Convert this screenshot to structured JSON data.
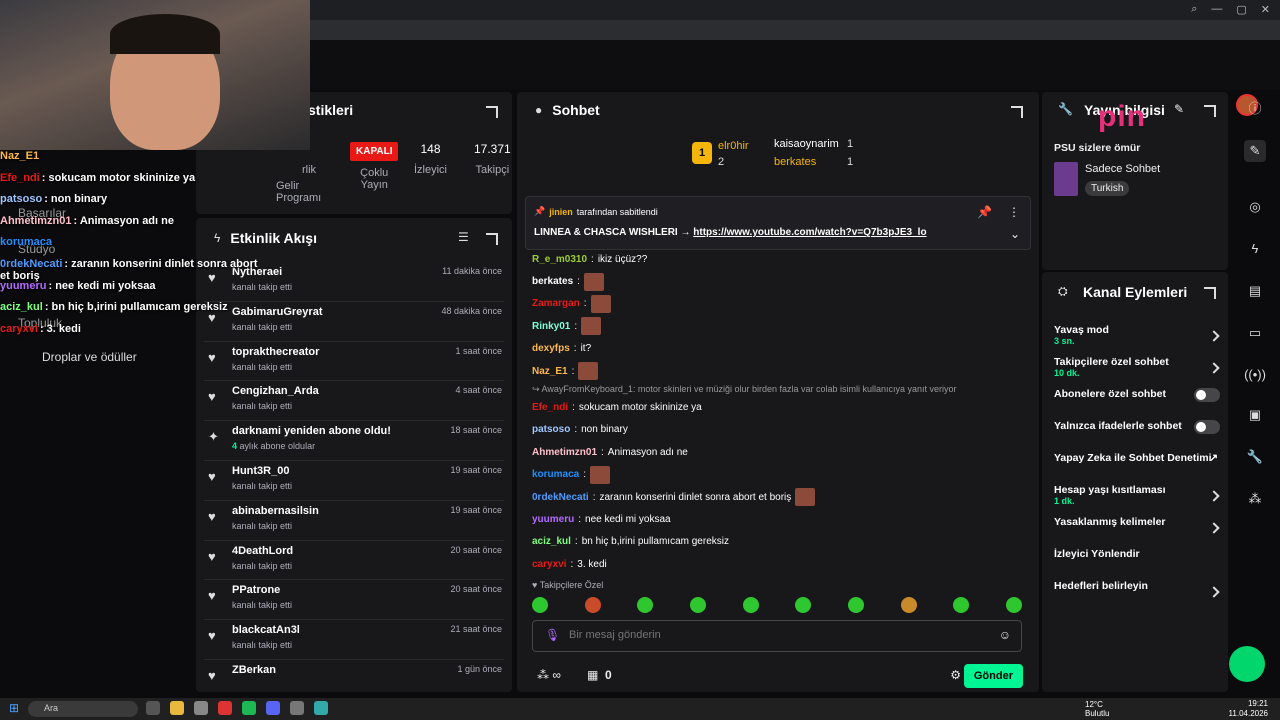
{
  "stats": {
    "title_partial": "stikleri",
    "status_badge": "KAPALI",
    "viewers": "148",
    "viewers_label": "İzleyici",
    "followers": "17.371",
    "followers_label": "Takipçi",
    "multi_label_1": "Çoklu",
    "multi_label_2": "Yayın",
    "income_label_1": "Gelir",
    "income_label_2": "Programı",
    "partial_lik": "rlik"
  },
  "feed": {
    "title": "Etkinlik Akışı",
    "items": [
      {
        "name": "Nytheraei",
        "sub": "kanalı takip etti",
        "time": "11 dakika önce",
        "icon": "heart"
      },
      {
        "name": "GabimaruGreyrat",
        "sub": "kanalı takip etti",
        "time": "48 dakika önce",
        "icon": "heart"
      },
      {
        "name": "toprakthecreator",
        "sub": "kanalı takip etti",
        "time": "1 saat önce",
        "icon": "heart"
      },
      {
        "name": "Cengizhan_Arda",
        "sub": "kanalı takip etti",
        "time": "4 saat önce",
        "icon": "heart"
      },
      {
        "name": "darknami yeniden abone oldu!",
        "sub_count": "4",
        "sub": " aylık abone oldular",
        "time": "18 saat önce",
        "icon": "star"
      },
      {
        "name": "Hunt3R_00",
        "sub": "kanalı takip etti",
        "time": "19 saat önce",
        "icon": "heart"
      },
      {
        "name": "abinabernasilsin",
        "sub": "kanalı takip etti",
        "time": "19 saat önce",
        "icon": "heart"
      },
      {
        "name": "4DeathLord",
        "sub": "kanalı takip etti",
        "time": "20 saat önce",
        "icon": "heart"
      },
      {
        "name": "PPatrone",
        "sub": "kanalı takip etti",
        "time": "20 saat önce",
        "icon": "heart"
      },
      {
        "name": "blackcatAn3l",
        "sub": "kanalı takip etti",
        "time": "21 saat önce",
        "icon": "heart"
      },
      {
        "name": "ZBerkan",
        "sub": "",
        "time": "1 gün önce",
        "icon": "heart"
      }
    ]
  },
  "chat": {
    "title": "Sohbet",
    "leaders": [
      {
        "rank": "1",
        "name": "elr0hir",
        "count": "2"
      },
      {
        "name": "kaisaoynarim",
        "count": "1"
      },
      {
        "name": "berkates",
        "count": "1"
      }
    ],
    "pinned": {
      "by_user": "jinien",
      "by_text": "tarafından sabitlendi",
      "text": "LINNEA & CHASCA WISHLERI →",
      "link": "https://www.youtube.com/watch?v=Q7b3pJE3_lo"
    },
    "messages": [
      {
        "user": "R_e_m0310",
        "color": "#9acd32",
        "text": "ikiz üçüz??",
        "emote": false
      },
      {
        "user": "berkates",
        "color": "#ffffff",
        "text": "",
        "emote": true
      },
      {
        "user": "Zamargan",
        "color": "#e91916",
        "text": "",
        "emote": true
      },
      {
        "user": "Rinky01",
        "color": "#7fffd4",
        "text": "",
        "emote": true
      },
      {
        "user": "dexyfps",
        "color": "#ffb84d",
        "text": "it?",
        "emote": false
      },
      {
        "user": "Naz_E1",
        "color": "#ffb84d",
        "text": "",
        "emote": true
      },
      {
        "user": "Efe_ndi",
        "color": "#e91916",
        "text": "sokucam motor skininize ya",
        "emote": false,
        "reply": "AwayFromKeyboard_1: motor skinleri ve müziği olur birden fazla var colab isimli kullanıcıya yanıt veriyor"
      },
      {
        "user": "patsoso",
        "color": "#9ec6ff",
        "text": "non binary",
        "emote": false
      },
      {
        "user": "Ahmetimzn01",
        "color": "#ffc0cb",
        "text": "Animasyon adı ne",
        "emote": false
      },
      {
        "user": "korumaca",
        "color": "#1e90ff",
        "text": "",
        "emote": true
      },
      {
        "user": "0rdekNecati",
        "color": "#4f9bff",
        "text": "zaranın konserini dinlet sonra abort et boriş",
        "emote": true
      },
      {
        "user": "yuumeru",
        "color": "#b36bff",
        "text": "nee kedi mi yoksaa",
        "emote": false
      },
      {
        "user": "aciz_kul",
        "color": "#7fff7f",
        "text": "bn hiç b,irini pullamıcam gereksiz",
        "emote": false
      },
      {
        "user": "caryxvi",
        "color": "#e91916",
        "text": "3. kedi",
        "emote": false
      }
    ],
    "followers_only": "Takipçilere Özel",
    "input_placeholder": "Bir mesaj gönderin",
    "points": "0",
    "send_label": "Gönder"
  },
  "info": {
    "title": "Yayın bilgisi",
    "stream_title": "PSU sizlere ömür",
    "mode": "Sadece Sohbet",
    "tag": "Turkish"
  },
  "actions": {
    "title": "Kanal Eylemleri",
    "items": [
      {
        "label": "Yavaş mod",
        "sub": "3 sn.",
        "type": "chevron"
      },
      {
        "label": "Takipçilere özel sohbet",
        "sub": "10 dk.",
        "type": "chevron"
      },
      {
        "label": "Abonelere özel sohbet",
        "sub": "",
        "type": "toggle"
      },
      {
        "label": "Yalnızca ifadelerle sohbet",
        "sub": "",
        "type": "toggle"
      },
      {
        "label": "Yapay Zeka ile Sohbet Denetimi",
        "sub": "",
        "type": "external"
      },
      {
        "label": "Hesap yaşı kısıtlaması",
        "sub": "1 dk.",
        "type": "chevron"
      },
      {
        "label": "Yasaklanmış kelimeler",
        "sub": "",
        "type": "chevron"
      },
      {
        "label": "İzleyici Yönlendir",
        "sub": "",
        "type": "none"
      },
      {
        "label": "Hedefleri belirleyin",
        "sub": "",
        "type": "chevron"
      }
    ]
  },
  "overlay": {
    "logo": "pin",
    "nav": [
      "Başarılar",
      "Stüdyo",
      "Topluluk",
      "Droplar ve ödüller"
    ],
    "obs_chat": [
      {
        "user": "Naz_E1",
        "color": "#ffb84d",
        "text": ""
      },
      {
        "user": "Efe_ndi",
        "color": "#e91916",
        "text": ": sokucam motor skininize ya"
      },
      {
        "user": "patsoso",
        "color": "#9ec6ff",
        "text": ": non binary"
      },
      {
        "user": "Ahmetimzn01",
        "color": "#ffc0cb",
        "text": ": Animasyon adı ne"
      },
      {
        "user": "korumaca",
        "color": "#1e90ff",
        "text": ""
      },
      {
        "user": "0rdekNecati",
        "color": "#4f9bff",
        "text": ": zaranın konserini dinlet sonra abort et boriş"
      },
      {
        "user": "yuumeru",
        "color": "#b36bff",
        "text": ": nee kedi mi yoksaa"
      },
      {
        "user": "aciz_kul",
        "color": "#7fff7f",
        "text": ": bn hiç b,irini pullamıcam gereksiz"
      },
      {
        "user": "caryxvi",
        "color": "#e91916",
        "text": ": 3. kedi"
      }
    ]
  },
  "taskbar": {
    "search": "Ara",
    "weather_temp": "12°C",
    "weather_desc": "Bulutlu",
    "time": "19:21",
    "date": "11.04.2026"
  }
}
